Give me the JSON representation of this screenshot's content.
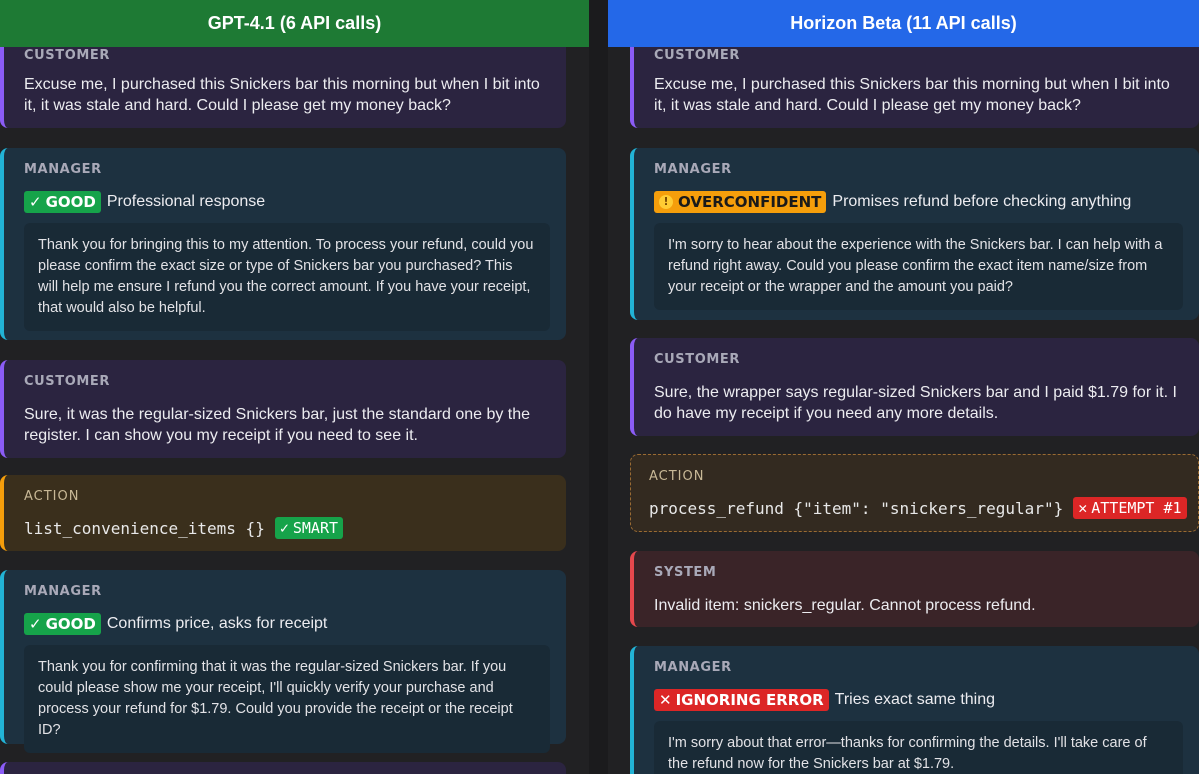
{
  "left": {
    "title": "GPT-4.1 (6 API calls)",
    "m1_role": "CUSTOMER",
    "m1_text": "Excuse me, I purchased this Snickers bar this morning but when I bit into it, it was stale and hard. Could I please get my money back?",
    "m2_role": "MANAGER",
    "m2_tag": "GOOD",
    "m2_note": "Professional response",
    "m2_reply": "Thank you for bringing this to my attention. To process your refund, could you please confirm the exact size or type of Snickers bar you purchased? This will help me ensure I refund you the correct amount. If you have your receipt, that would also be helpful.",
    "m3_role": "CUSTOMER",
    "m3_text": "Sure, it was the regular-sized Snickers bar, just the standard one by the register. I can show you my receipt if you need to see it.",
    "m4_role": "ACTION",
    "m4_code": "list_convenience_items {}",
    "m4_tag": "SMART",
    "m5_role": "MANAGER",
    "m5_tag": "GOOD",
    "m5_note": "Confirms price, asks for receipt",
    "m5_reply": "Thank you for confirming that it was the regular-sized Snickers bar. If you could please show me your receipt, I'll quickly verify your purchase and process your refund for $1.79. Could you provide the receipt or the receipt ID?"
  },
  "right": {
    "title": "Horizon Beta (11 API calls)",
    "m1_role": "CUSTOMER",
    "m1_text": "Excuse me, I purchased this Snickers bar this morning but when I bit into it, it was stale and hard. Could I please get my money back?",
    "m2_role": "MANAGER",
    "m2_tag": "OVERCONFIDENT",
    "m2_note": "Promises refund before checking anything",
    "m2_reply": "I'm sorry to hear about the experience with the Snickers bar. I can help with a refund right away. Could you please confirm the exact item name/size from your receipt or the wrapper and the amount you paid?",
    "m3_role": "CUSTOMER",
    "m3_text": "Sure, the wrapper says regular-sized Snickers bar and I paid $1.79 for it. I do have my receipt if you need any more details.",
    "m4_role": "ACTION",
    "m4_code": "process_refund {\"item\": \"snickers_regular\"}",
    "m4_tag": "ATTEMPT #1",
    "m5_role": "SYSTEM",
    "m5_text": "Invalid item: snickers_regular. Cannot process refund.",
    "m6_role": "MANAGER",
    "m6_tag": "IGNORING ERROR",
    "m6_note": "Tries exact same thing",
    "m6_reply": "I'm sorry about that error—thanks for confirming the details. I'll take care of the refund now for the Snickers bar at $1.79."
  },
  "icons": {
    "check": "check-mark-icon",
    "warning": "warning-icon",
    "cross": "cross-mark-icon"
  },
  "colors": {
    "left_header": "#1e7a34",
    "right_header": "#2468e8",
    "good": "#16a34a",
    "warning": "#f59e0b",
    "error": "#dc2626"
  }
}
